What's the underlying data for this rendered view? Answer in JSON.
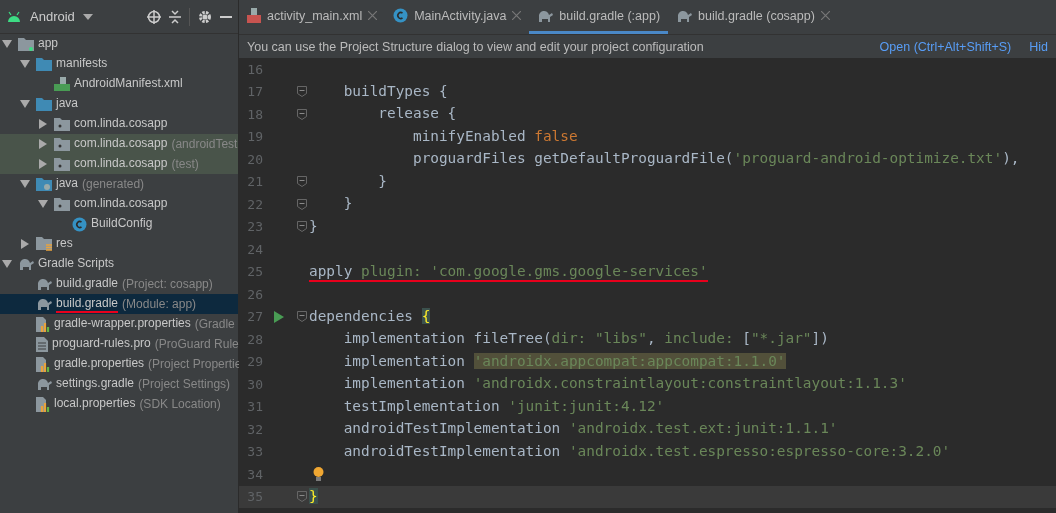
{
  "project_panel": {
    "view": "Android",
    "tree": [
      {
        "label": "app",
        "kind": "module",
        "expanded": true,
        "children": [
          {
            "label": "manifests",
            "kind": "folder",
            "expanded": true,
            "children": [
              {
                "label": "AndroidManifest.xml",
                "kind": "manifest"
              }
            ]
          },
          {
            "label": "java",
            "kind": "folder",
            "expanded": true,
            "children": [
              {
                "label": "com.linda.cosapp",
                "kind": "package",
                "expanded": false,
                "test_source": false
              },
              {
                "label": "com.linda.cosapp",
                "hint": "(androidTest",
                "kind": "package",
                "expanded": false,
                "test_source": true
              },
              {
                "label": "com.linda.cosapp",
                "hint": "(test)",
                "kind": "package",
                "expanded": false,
                "test_source": true
              }
            ]
          },
          {
            "label": "java",
            "hint": "(generated)",
            "kind": "generated",
            "expanded": true,
            "children": [
              {
                "label": "com.linda.cosapp",
                "kind": "package",
                "expanded": true,
                "children": [
                  {
                    "label": "BuildConfig",
                    "kind": "class"
                  }
                ]
              }
            ]
          },
          {
            "label": "res",
            "kind": "res",
            "expanded": false
          }
        ]
      },
      {
        "label": "Gradle Scripts",
        "kind": "gradle",
        "expanded": true,
        "children": [
          {
            "label": "build.gradle",
            "hint": "(Project: cosapp)",
            "kind": "gradle",
            "selected": false,
            "underlined": false
          },
          {
            "label": "build.gradle",
            "hint": "(Module: app)",
            "kind": "gradle",
            "selected": true,
            "underlined": true
          },
          {
            "label": "gradle-wrapper.properties",
            "hint": "(Gradle",
            "kind": "properties",
            "selected": false,
            "underlined": false
          },
          {
            "label": "proguard-rules.pro",
            "hint": "(ProGuard Rule",
            "kind": "text",
            "selected": false,
            "underlined": false
          },
          {
            "label": "gradle.properties",
            "hint": "(Project Propertie",
            "kind": "properties",
            "selected": false,
            "underlined": false
          },
          {
            "label": "settings.gradle",
            "hint": "(Project Settings)",
            "kind": "gradle",
            "selected": false,
            "underlined": false
          },
          {
            "label": "local.properties",
            "hint": "(SDK Location)",
            "kind": "properties",
            "selected": false,
            "underlined": false
          }
        ]
      }
    ]
  },
  "tabs": [
    {
      "label": "activity_main.xml",
      "kind": "xml",
      "selected": false
    },
    {
      "label": "MainActivity.java",
      "kind": "class",
      "selected": false
    },
    {
      "label": "build.gradle (:app)",
      "kind": "gradle",
      "selected": true
    },
    {
      "label": "build.gradle (cosapp)",
      "kind": "gradle",
      "selected": false
    }
  ],
  "banner": {
    "message": "You can use the Project Structure dialog to view and edit your project configuration",
    "action": "Open (Ctrl+Alt+Shift+S)",
    "action_2": "Hid"
  },
  "editor": {
    "lines": [
      {
        "number": "16"
      },
      {
        "number": "17",
        "fold": true,
        "tokens": [
          {
            "text": "    buildTypes {",
            "kind": "plain"
          }
        ]
      },
      {
        "number": "18",
        "fold": true,
        "tokens": [
          {
            "text": "        release {",
            "kind": "plain"
          }
        ]
      },
      {
        "number": "19",
        "tokens": [
          {
            "text": "            minifyEnabled ",
            "kind": "plain"
          },
          {
            "text": "false",
            "kind": "keyword"
          }
        ]
      },
      {
        "number": "20",
        "tokens": [
          {
            "text": "            proguardFiles getDefaultProguardFile(",
            "kind": "plain"
          },
          {
            "text": "'proguard-android-optimize.txt'",
            "kind": "string"
          },
          {
            "text": "),",
            "kind": "plain"
          }
        ]
      },
      {
        "number": "21",
        "fold": true,
        "tokens": [
          {
            "text": "        }",
            "kind": "plain"
          }
        ]
      },
      {
        "number": "22",
        "fold": true,
        "tokens": [
          {
            "text": "    }",
            "kind": "plain"
          }
        ]
      },
      {
        "number": "23",
        "fold": true,
        "tokens": [
          {
            "text": "}",
            "kind": "plain"
          }
        ]
      },
      {
        "number": "24"
      },
      {
        "number": "25",
        "underlined": true,
        "tokens": [
          {
            "text": "apply ",
            "kind": "plain"
          },
          {
            "text": "plugin: ",
            "kind": "named"
          },
          {
            "text": "'com.google.gms.google-services'",
            "kind": "string"
          }
        ]
      },
      {
        "number": "26"
      },
      {
        "number": "27",
        "fold": true,
        "run": true,
        "tokens": [
          {
            "text": "dependencies ",
            "kind": "plain"
          },
          {
            "text": "{",
            "kind": "brace"
          }
        ]
      },
      {
        "number": "28",
        "tokens": [
          {
            "text": "    implementation fileTree(",
            "kind": "plain"
          },
          {
            "text": "dir: ",
            "kind": "named"
          },
          {
            "text": "\"libs\"",
            "kind": "string"
          },
          {
            "text": ", ",
            "kind": "plain"
          },
          {
            "text": "include: ",
            "kind": "named"
          },
          {
            "text": "[",
            "kind": "plain"
          },
          {
            "text": "\"*.jar\"",
            "kind": "string"
          },
          {
            "text": "])",
            "kind": "plain"
          }
        ]
      },
      {
        "number": "29",
        "tokens": [
          {
            "text": "    implementation ",
            "kind": "plain"
          },
          {
            "text": "'androidx.appcompat:appcompat:1.1.0'",
            "kind": "highlighted"
          }
        ]
      },
      {
        "number": "30",
        "tokens": [
          {
            "text": "    implementation ",
            "kind": "plain"
          },
          {
            "text": "'androidx.constraintlayout:constraintlayout:1.1.3'",
            "kind": "string"
          }
        ]
      },
      {
        "number": "31",
        "tokens": [
          {
            "text": "    testImplementation ",
            "kind": "plain"
          },
          {
            "text": "'junit:junit:4.12'",
            "kind": "string"
          }
        ]
      },
      {
        "number": "32",
        "tokens": [
          {
            "text": "    androidTestImplementation ",
            "kind": "plain"
          },
          {
            "text": "'androidx.test.ext:junit:1.1.1'",
            "kind": "string"
          }
        ]
      },
      {
        "number": "33",
        "tokens": [
          {
            "text": "    androidTestImplementation ",
            "kind": "plain"
          },
          {
            "text": "'androidx.test.espresso:espresso-core:3.2.0'",
            "kind": "string"
          }
        ]
      },
      {
        "number": "34",
        "hint": true
      },
      {
        "number": "35",
        "fold": true,
        "current": true,
        "tokens": [
          {
            "text": "}",
            "kind": "brace"
          }
        ]
      }
    ]
  }
}
